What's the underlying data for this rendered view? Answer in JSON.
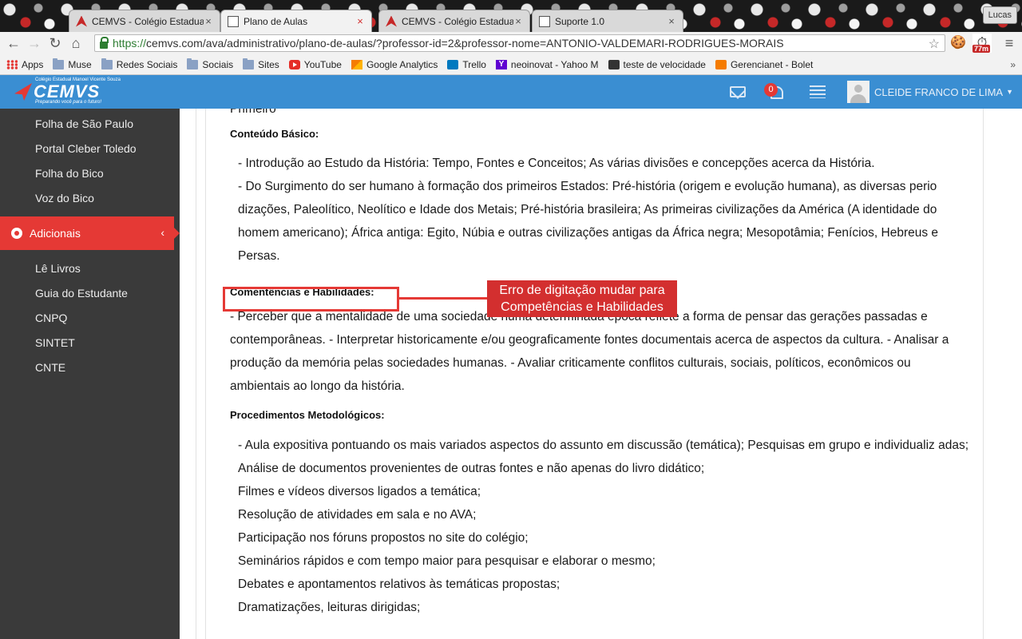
{
  "browser": {
    "tabs": [
      {
        "title": "CEMVS - Colégio Estadual",
        "active": false
      },
      {
        "title": "Plano de Aulas",
        "active": true
      },
      {
        "title": "CEMVS - Colégio Estadual",
        "active": false
      },
      {
        "title": "Suporte 1.0",
        "active": false
      }
    ],
    "profile_name": "Lucas",
    "url_scheme": "https://",
    "url_rest": "cemvs.com/ava/administrativo/plano-de-aulas/?professor-id=2&professor-nome=ANTONIO-VALDEMARI-RODRIGUES-MORAIS",
    "timer_badge": "77m",
    "bookmarks": [
      {
        "label": "Apps",
        "icon": "apps-icon"
      },
      {
        "label": "Muse",
        "icon": "folder-icon"
      },
      {
        "label": "Redes Sociais",
        "icon": "folder-icon"
      },
      {
        "label": "Sociais",
        "icon": "folder-icon"
      },
      {
        "label": "Sites",
        "icon": "folder-icon"
      },
      {
        "label": "YouTube",
        "icon": "youtube-icon"
      },
      {
        "label": "Google Analytics",
        "icon": "analytics-icon"
      },
      {
        "label": "Trello",
        "icon": "trello-icon"
      },
      {
        "label": "neoinovat - Yahoo M",
        "icon": "yahoo-icon"
      },
      {
        "label": "teste de velocidade",
        "icon": "speedtest-icon"
      },
      {
        "label": "Gerencianet - Bolet",
        "icon": "gerencianet-icon"
      }
    ],
    "bookmarks_more": "»"
  },
  "header": {
    "logo_text": "CEMVS",
    "logo_small": "Colégio Estadual Manoel Vicente Souza",
    "logo_tagline": "Preparando você para o futuro!",
    "notification_count": "0",
    "user_name": "CLEIDE FRANCO DE LIMA"
  },
  "sidebar": {
    "links_top": [
      "Folha de São Paulo",
      "Portal Cleber Toledo",
      "Folha do Bico",
      "Voz do Bico"
    ],
    "active_section": "Adicionais",
    "links_bottom": [
      "Lê Livros",
      "Guia do Estudante",
      "CNPQ",
      "SINTET",
      "CNTE"
    ]
  },
  "content": {
    "cut_off_top": "Primeiro",
    "conteudo_heading": "Conteúdo Básico:",
    "conteudo_items": [
      "- Introdução ao Estudo da História: Tempo, Fontes e Conceitos; As várias divisões e concepções acerca da História.",
      "- Do Surgimento do ser humano à formação dos primeiros Estados: Pré-história (origem e evolução humana), as diversas perio dizações, Paleolítico, Neolítico e Idade dos Metais; Pré-história brasileira; As primeiras civilizações da América (A identidade do homem americano); África antiga: Egito, Núbia e outras civilizações antigas da África negra; Mesopotâmia; Fenícios, Hebreus e Persas."
    ],
    "competencias_heading": "Comentências e Habilidades:",
    "competencias_text": "- Perceber que a mentalidade de uma sociedade numa determinada época reflete a forma de pensar das gerações passadas e contemporâneas. - Interpretar historicamente e/ou geograficamente fontes documentais acerca de aspectos da cultura. - Analisar a produção da memória pelas sociedades humanas. - Avaliar criticamente conflitos culturais, sociais, políticos, econômicos ou ambientais ao longo da história.",
    "procedimentos_heading": "Procedimentos Metodológicos:",
    "procedimentos_items": [
      "- Aula expositiva pontuando os mais variados aspectos do assunto em discussão (temática); Pesquisas em grupo e individualiz adas;",
      "Análise de documentos provenientes de outras fontes e não apenas do livro didático;",
      "Filmes e vídeos diversos ligados a temática;",
      "Resolução de atividades em sala e no AVA;",
      "Participação nos fóruns propostos no site do colégio;",
      "Seminários rápidos e com tempo maior para pesquisar e elaborar o mesmo;",
      "Debates e apontamentos relativos às temáticas propostas;",
      "Dramatizações, leituras dirigidas;"
    ]
  },
  "annotation": {
    "line1": "Erro de digitação mudar para",
    "line2": "Competências e Habilidades"
  },
  "colors": {
    "header_blue": "#3a8ed2",
    "sidebar_dark": "#3a3a3a",
    "accent_red": "#e53935"
  }
}
